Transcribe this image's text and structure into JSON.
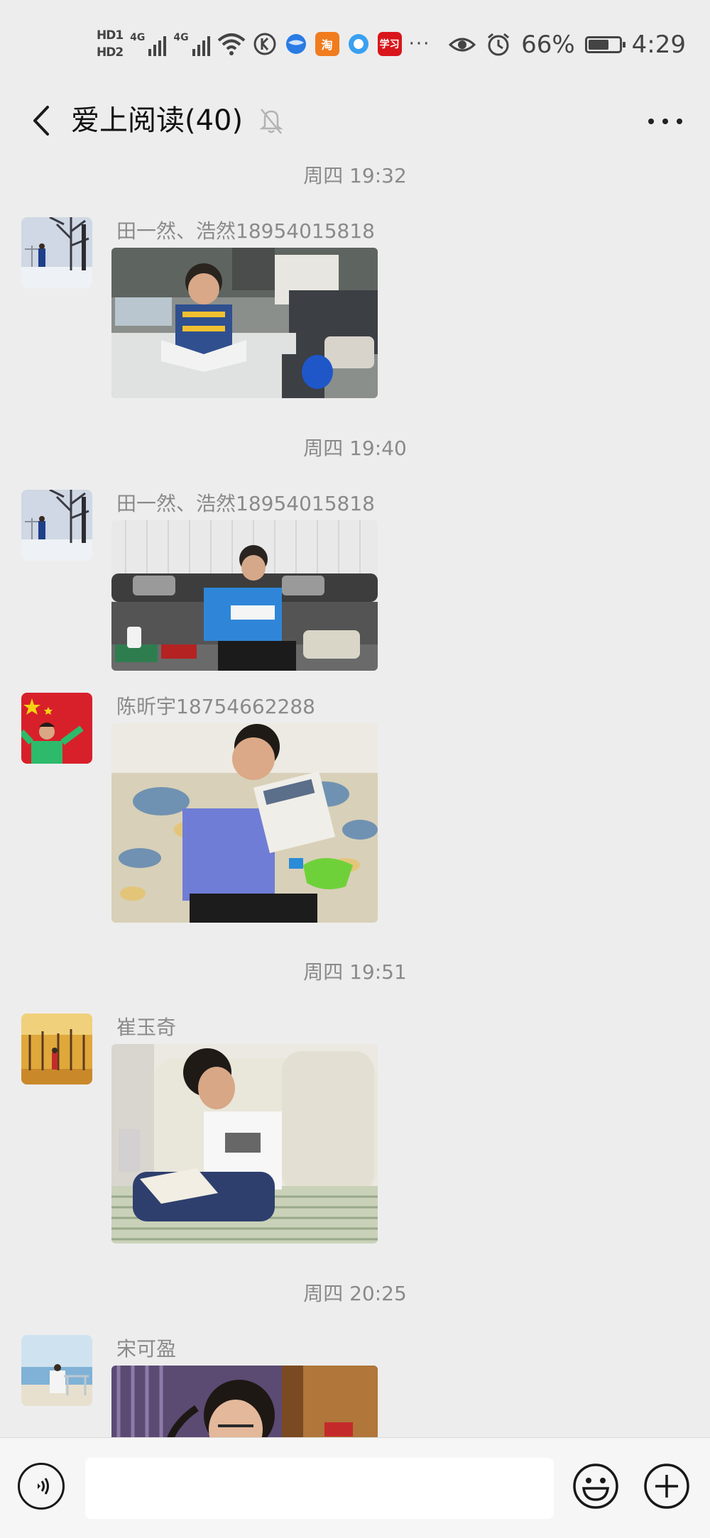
{
  "status_bar": {
    "hd1": "HD1",
    "hd2": "HD2",
    "net1": "4G",
    "net2": "4G",
    "icons": [
      "wifi-icon",
      "k-app-icon",
      "browser-icon",
      "taobao-icon",
      "qq-browser-icon",
      "xuexi-icon"
    ],
    "xuexi_text": "学习",
    "more": "···",
    "battery_percent": "66%",
    "battery_level": 0.66,
    "time": "4:29"
  },
  "header": {
    "title": "爱上阅读(40)"
  },
  "messages": [
    {
      "time": "周四 19:32"
    },
    {
      "sender": "田一然、浩然18954015818",
      "avatar": "winter-tree-avatar",
      "image": "boy-reading-at-table-photo"
    },
    {
      "time": "周四 19:40"
    },
    {
      "sender": "田一然、浩然18954015818",
      "avatar": "winter-tree-avatar",
      "image": "boy-reading-on-sofa-photo"
    },
    {
      "sender": "陈昕宇18754662288",
      "avatar": "flag-boy-avatar",
      "image": "boy-reading-aloud-photo"
    },
    {
      "time": "周四 19:51"
    },
    {
      "sender": "崔玉奇",
      "avatar": "autumn-trees-avatar",
      "image": "boy-reading-on-white-sofa-photo"
    },
    {
      "time": "周四 20:25"
    },
    {
      "sender": "宋可盈",
      "avatar": "seaside-avatar",
      "image": "girl-reading-photo"
    }
  ],
  "input": {
    "placeholder": "",
    "value": ""
  },
  "colors": {
    "background": "#ededed",
    "input_bar": "#f6f6f6",
    "meta_text": "#8a8a8a"
  }
}
